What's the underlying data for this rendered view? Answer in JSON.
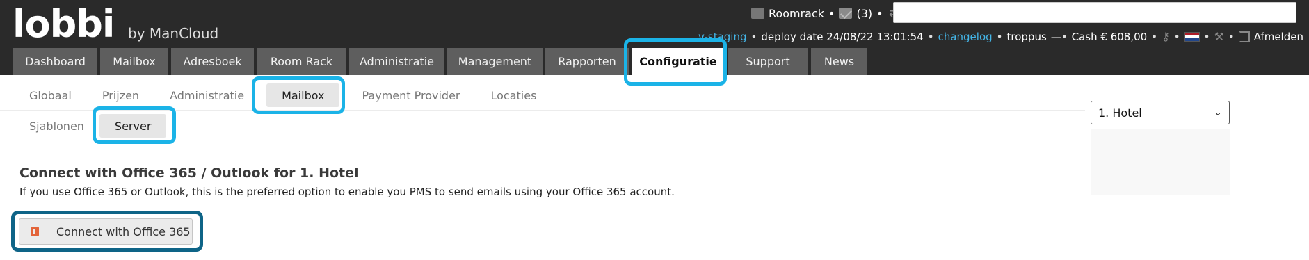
{
  "app": {
    "logo_text": "lobbi",
    "byline": "by ManCloud"
  },
  "topbar": {
    "roomrack_label": "Roomrack",
    "messages_count": "(3)",
    "search_value": ""
  },
  "info": {
    "env_link": "v-staging",
    "deploy": "deploy date 24/08/22 13:01:54",
    "changelog": "changelog",
    "user": "troppus",
    "cash": "Cash € 608,00",
    "logout": "Afmelden"
  },
  "main_tabs": [
    {
      "label": "Dashboard"
    },
    {
      "label": "Mailbox"
    },
    {
      "label": "Adresboek"
    },
    {
      "label": "Room Rack"
    },
    {
      "label": "Administratie"
    },
    {
      "label": "Management"
    },
    {
      "label": "Rapporten"
    },
    {
      "label": "Configuratie",
      "active": true
    },
    {
      "label": "Support"
    },
    {
      "label": "News"
    }
  ],
  "sub_tabs_row1": [
    {
      "label": "Globaal"
    },
    {
      "label": "Prijzen"
    },
    {
      "label": "Administratie"
    },
    {
      "label": "Mailbox",
      "active": true
    },
    {
      "label": "Payment Provider"
    },
    {
      "label": "Locaties"
    }
  ],
  "sub_tabs_row2": [
    {
      "label": "Sjablonen"
    },
    {
      "label": "Server",
      "active": true
    }
  ],
  "hotel_select": {
    "value": "1. Hotel"
  },
  "content": {
    "title": "Connect with Office 365 / Outlook for 1. Hotel",
    "description": "If you use Office 365 or Outlook, this is the preferred option to enable you PMS to send emails using your Office 365 account.",
    "button_label": "Connect with Office 365"
  },
  "colors": {
    "header_bg": "#2a2a2a",
    "tab_bg": "#5e5e5e",
    "link": "#44b6e8",
    "highlight": "#1bb3e7",
    "highlight_dark": "#0e6487"
  }
}
